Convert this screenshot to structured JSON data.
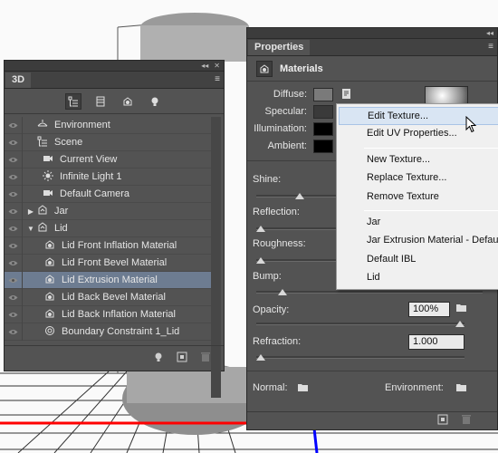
{
  "panel3d": {
    "tab_label": "3D",
    "menu_glyph": "≡",
    "collapse_glyph": "◂◂",
    "close_glyph": "✕",
    "filter_icons": [
      "scene-filter-icon",
      "mesh-filter-icon",
      "material-filter-icon",
      "light-filter-icon"
    ],
    "items": [
      {
        "label": "Environment",
        "icon": "environment-icon",
        "indent": 0,
        "expand": ""
      },
      {
        "label": "Scene",
        "icon": "scene-icon",
        "indent": 0,
        "expand": ""
      },
      {
        "label": "Current View",
        "icon": "camera-icon",
        "indent": 1,
        "expand": ""
      },
      {
        "label": "Infinite Light 1",
        "icon": "light-icon",
        "indent": 1,
        "expand": ""
      },
      {
        "label": "Default Camera",
        "icon": "camera-icon",
        "indent": 1,
        "expand": ""
      },
      {
        "label": "Jar",
        "icon": "mesh-icon",
        "indent": 0,
        "expand": "▶"
      },
      {
        "label": "Lid",
        "icon": "mesh-icon",
        "indent": 0,
        "expand": "▼"
      },
      {
        "label": "Lid Front Inflation Material",
        "icon": "material-icon",
        "indent": 2,
        "expand": ""
      },
      {
        "label": "Lid Front Bevel Material",
        "icon": "material-icon",
        "indent": 2,
        "expand": ""
      },
      {
        "label": "Lid Extrusion Material",
        "icon": "material-icon",
        "indent": 2,
        "expand": "",
        "selected": true
      },
      {
        "label": "Lid Back Bevel Material",
        "icon": "material-icon",
        "indent": 2,
        "expand": ""
      },
      {
        "label": "Lid Back Inflation Material",
        "icon": "material-icon",
        "indent": 2,
        "expand": ""
      },
      {
        "label": "Boundary Constraint 1_Lid",
        "icon": "constraint-icon",
        "indent": 2,
        "expand": ""
      }
    ]
  },
  "properties": {
    "tab_label": "Properties",
    "section_title": "Materials",
    "diffuse_label": "Diffuse:",
    "specular_label": "Specular:",
    "illumination_label": "Illumination:",
    "ambient_label": "Ambient:",
    "shine_label": "Shine:",
    "reflection_label": "Reflection:",
    "roughness_label": "Roughness:",
    "bump_label": "Bump:",
    "opacity_label": "Opacity:",
    "opacity_value": "100%",
    "refraction_label": "Refraction:",
    "refraction_value": "1.000",
    "normal_label": "Normal:",
    "environment_label": "Environment:",
    "colors": {
      "diffuse": "#7a7a7a",
      "specular": "#3a3a3a",
      "illumination": "#000000",
      "ambient": "#000000"
    },
    "slider_levels": {
      "shine": 0.18,
      "reflection": 0.0,
      "roughness": 0.0,
      "bump": 0.1,
      "opacity": 1.0,
      "refraction": 0.0
    }
  },
  "context_menu": {
    "items": [
      {
        "label": "Edit Texture...",
        "highlighted": true
      },
      {
        "label": "Edit UV Properties..."
      },
      {
        "separator": true
      },
      {
        "label": "New Texture..."
      },
      {
        "label": "Replace Texture..."
      },
      {
        "label": "Remove Texture"
      },
      {
        "separator": true
      },
      {
        "label": "Jar"
      },
      {
        "label": "Jar Extrusion Material - Defau"
      },
      {
        "label": "Default IBL"
      },
      {
        "label": "Lid"
      }
    ]
  },
  "accent": {
    "selection": "#6d7c91",
    "panel_bg": "#535353",
    "menu_highlight": "#d9e5f3"
  }
}
